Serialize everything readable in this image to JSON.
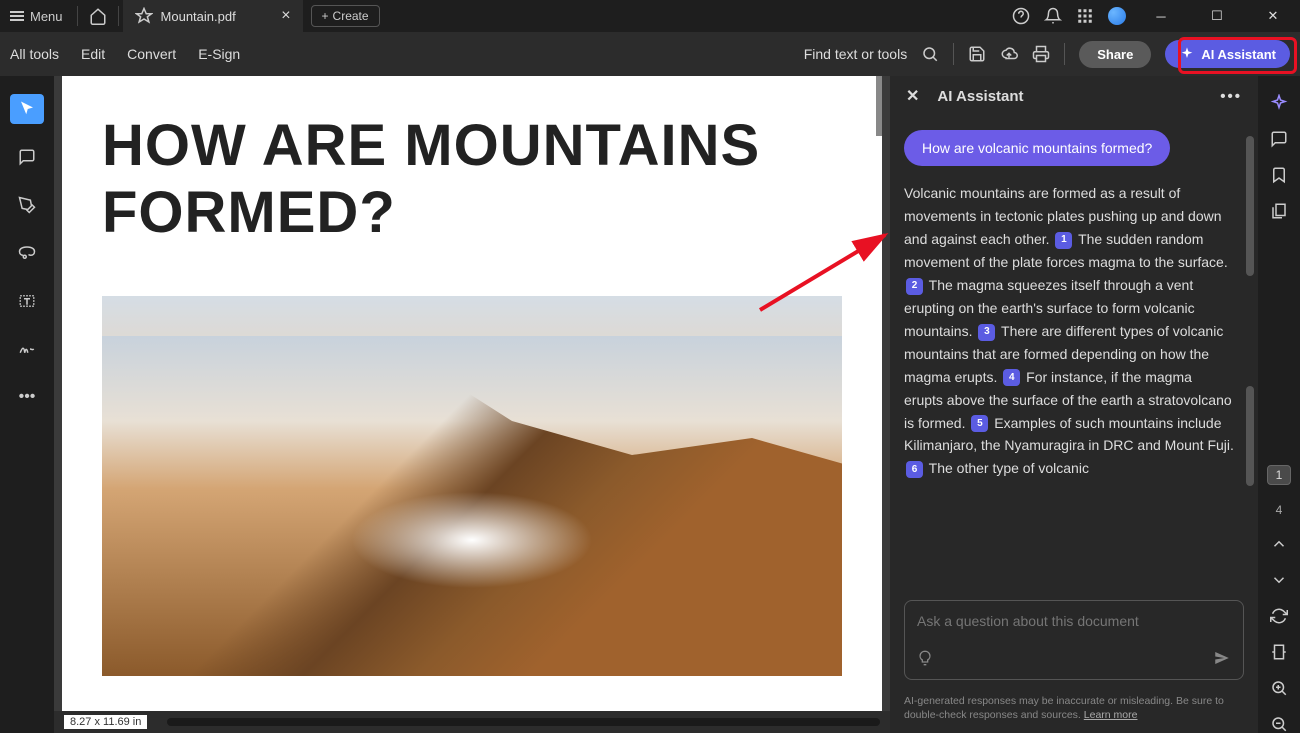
{
  "titlebar": {
    "menu_label": "Menu",
    "tab_name": "Mountain.pdf",
    "create_label": "Create"
  },
  "toolbar": {
    "all_tools": "All tools",
    "edit": "Edit",
    "convert": "Convert",
    "esign": "E-Sign",
    "find_label": "Find text or tools",
    "share_label": "Share",
    "ai_label": "AI Assistant"
  },
  "document": {
    "title": "HOW ARE MOUNTAINS FORMED?",
    "dimensions": "8.27 x 11.69 in"
  },
  "ai_panel": {
    "title": "AI Assistant",
    "question": "How are volcanic mountains formed?",
    "answer_parts": {
      "p1": "Volcanic mountains are formed as a result of movements in tectonic plates pushing up and down and against each other.",
      "p2": "The sudden random movement of the plate forces magma to the surface.",
      "p3": "The magma squeezes itself through a vent erupting on the earth's surface to form volcanic mountains.",
      "p4": "There are different types of volcanic mountains that are formed depending on how the magma erupts.",
      "p5": "For instance, if the magma erupts above the surface of the earth a stratovolcano is formed.",
      "p6": "Examples of such mountains include Kilimanjaro, the Nyamuragira in DRC and Mount Fuji.",
      "p7": "The other type of volcanic"
    },
    "citations": {
      "c1": "1",
      "c2": "2",
      "c3": "3",
      "c4": "4",
      "c5": "5",
      "c6": "6"
    },
    "input_placeholder": "Ask a question about this document",
    "disclaimer": "AI-generated responses may be inaccurate or misleading. Be sure to double-check responses and sources.",
    "learn_more": "Learn more"
  },
  "paging": {
    "current": "1",
    "total": "4"
  }
}
